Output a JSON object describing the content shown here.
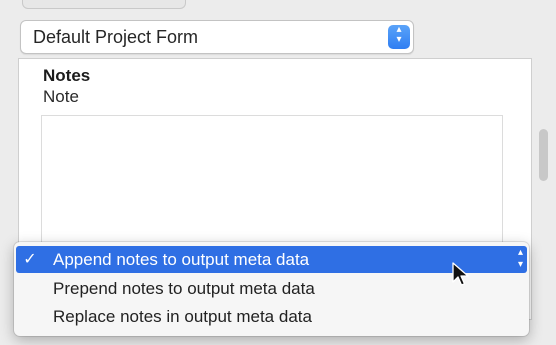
{
  "project_form": {
    "selected_label": "Default Project Form",
    "stepper_icon": "updown-chevron-icon"
  },
  "notes": {
    "section_title": "Notes",
    "field_label": "Note",
    "field_value": ""
  },
  "menu": {
    "items": [
      {
        "label": "Append notes to output meta data",
        "checked": true,
        "check_mark": "✓"
      },
      {
        "label": "Prepend notes to output meta data",
        "checked": false
      },
      {
        "label": "Replace notes in output meta data",
        "checked": false
      }
    ]
  },
  "colors": {
    "highlight": "#2f6fe4",
    "stepper": "#2f7ef2"
  }
}
